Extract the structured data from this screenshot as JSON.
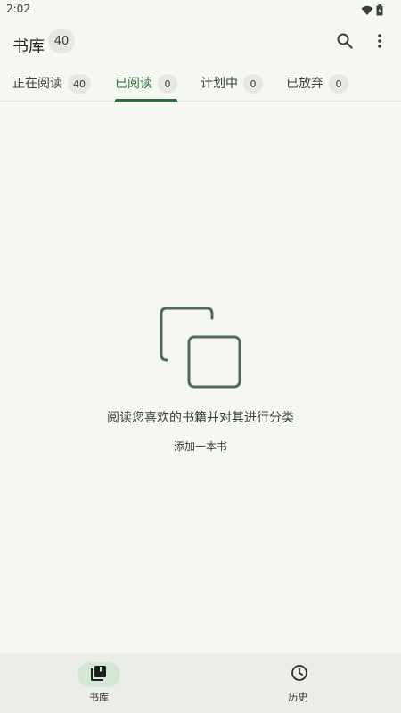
{
  "status_bar": {
    "time": "2:02",
    "icons": [
      "wifi-icon",
      "battery-icon"
    ]
  },
  "app_bar": {
    "title": "书库",
    "count": "40",
    "actions": [
      "search-icon",
      "more-vert-icon"
    ]
  },
  "tabs": [
    {
      "label": "正在阅读",
      "count": "40",
      "active": false
    },
    {
      "label": "已阅读",
      "count": "0",
      "active": true
    },
    {
      "label": "计划中",
      "count": "0",
      "active": false
    },
    {
      "label": "已放弃",
      "count": "0",
      "active": false
    }
  ],
  "empty_state": {
    "icon": "copy-squares-icon",
    "message": "阅读您喜欢的书籍并对其进行分类",
    "action": "添加一本书"
  },
  "bottom_nav": {
    "items": [
      {
        "label": "书库",
        "icon": "library-books-icon",
        "selected": true
      },
      {
        "label": "历史",
        "icon": "clock-icon",
        "selected": false
      }
    ]
  },
  "colors": {
    "background": "#f4f8f1",
    "accent": "#2e6b3d",
    "badge": "#e4e8e1",
    "nav_background": "#eaeee7",
    "nav_pill": "#d2e8d3"
  }
}
